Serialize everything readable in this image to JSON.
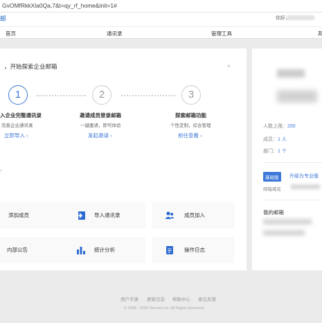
{
  "browser": {
    "url": "GvOMfRkkXla0Qa,7&t=qy_rf_home&init=1#"
  },
  "header": {
    "logo_text": "邮",
    "greeting": "你好，"
  },
  "nav": {
    "items": [
      "首页",
      "通讯录",
      "管理工具",
      "邦"
    ]
  },
  "welcome": {
    "title": "，开始探索企业邮箱",
    "close_label": "×",
    "steps": [
      {
        "number": "1",
        "title": "入企业完整通讯录",
        "desc": "完善企业通讯录",
        "link": "立即导入 ›",
        "state": "active"
      },
      {
        "number": "2",
        "title": "邀请成员登录邮箱",
        "desc": "一键邀请，即可体验",
        "link": "发起邀请 ›",
        "state": "inactive"
      },
      {
        "number": "3",
        "title": "探索邮箱功能",
        "desc": "个性定制，综合管理",
        "link": "前往查看 ›",
        "state": "inactive"
      }
    ]
  },
  "section_chevron": "›",
  "quick_actions": [
    {
      "label": "添加成员",
      "icon": "none"
    },
    {
      "label": "导入通讯录",
      "icon": "import-contacts-icon"
    },
    {
      "label": "成员加入",
      "icon": "member-join-icon"
    },
    {
      "label": "内部公告",
      "icon": "none"
    },
    {
      "label": "统计分析",
      "icon": "bar-chart-icon"
    },
    {
      "label": "操作日志",
      "icon": "log-icon"
    }
  ],
  "sidebar": {
    "stats": [
      {
        "label": "人数上限：",
        "value": "200"
      },
      {
        "label": "成员：",
        "value": "1 人"
      },
      {
        "label": "部门：",
        "value": "1 个"
      }
    ],
    "edition_badge": "基础版",
    "upgrade_link": "升级为专业版",
    "domain_label": "邮箱域名",
    "my_mailbox_title": "我的邮箱"
  },
  "footer": {
    "links": [
      "用户手册",
      "更新日志",
      "帮助中心",
      "意见反馈"
    ],
    "copyright": "© 1998 - 2020 Tencent Inc. All Rights Reserved"
  },
  "colors": {
    "accent": "#3c78d8",
    "page_bg": "#ebebeb",
    "panel_bg": "#ffffff"
  }
}
